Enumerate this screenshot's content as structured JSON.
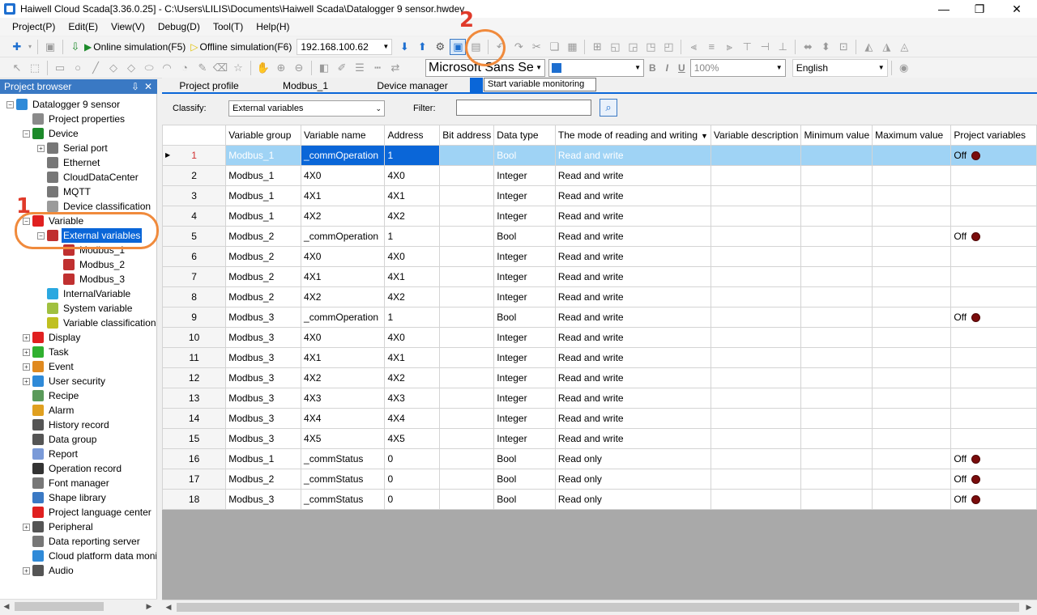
{
  "window": {
    "title": "Haiwell Cloud Scada[3.36.0.25] - C:\\Users\\LILIS\\Documents\\Haiwell Scada\\Datalogger 9 sensor.hwdev",
    "minimize": "—",
    "restore": "❐",
    "close": "✕"
  },
  "menu": [
    "Project(P)",
    "Edit(E)",
    "View(V)",
    "Debug(D)",
    "Tool(T)",
    "Help(H)"
  ],
  "toolbar": {
    "online_sim": "Online simulation(F5)",
    "offline_sim": "Offline simulation(F6)",
    "ip": "192.168.100.62",
    "font": "Microsoft Sans Se",
    "zoom": "100%",
    "language": "English",
    "bold": "B",
    "italic": "I",
    "underline": "U",
    "tooltip": "Start variable monitoring"
  },
  "annotations": {
    "one": "1",
    "two": "2"
  },
  "browser": {
    "title": "Project browser",
    "pin": "⇩",
    "close": "✕",
    "items": [
      {
        "label": "Datalogger 9 sensor",
        "color": "#2f8ad8"
      },
      {
        "label": "Project properties",
        "color": "#8a8a8a"
      },
      {
        "label": "Device",
        "color": "#1c8a2a"
      },
      {
        "label": "Serial port",
        "color": "#777777"
      },
      {
        "label": "Ethernet",
        "color": "#777777"
      },
      {
        "label": "CloudDataCenter",
        "color": "#777777"
      },
      {
        "label": "MQTT",
        "color": "#777777"
      },
      {
        "label": "Device classification",
        "color": "#9a9a9a"
      },
      {
        "label": "Variable",
        "color": "#e02020"
      },
      {
        "label": "External variables",
        "color": "#c03030"
      },
      {
        "label": "Modbus_1",
        "color": "#c03030"
      },
      {
        "label": "Modbus_2",
        "color": "#c03030"
      },
      {
        "label": "Modbus_3",
        "color": "#c03030"
      },
      {
        "label": "InternalVariable",
        "color": "#2aa8e0"
      },
      {
        "label": "System variable",
        "color": "#a0c040"
      },
      {
        "label": "Variable classification",
        "color": "#c0c020"
      },
      {
        "label": "Display",
        "color": "#e02020"
      },
      {
        "label": "Task",
        "color": "#30b030"
      },
      {
        "label": "Event",
        "color": "#e08a20"
      },
      {
        "label": "User security",
        "color": "#2f8ad8"
      },
      {
        "label": "Recipe",
        "color": "#5a9a5a"
      },
      {
        "label": "Alarm",
        "color": "#e0a020"
      },
      {
        "label": "History record",
        "color": "#555555"
      },
      {
        "label": "Data group",
        "color": "#555555"
      },
      {
        "label": "Report",
        "color": "#7a9ad8"
      },
      {
        "label": "Operation record",
        "color": "#333333"
      },
      {
        "label": "Font manager",
        "color": "#777777"
      },
      {
        "label": "Shape library",
        "color": "#3a79c4"
      },
      {
        "label": "Project language center",
        "color": "#e02020"
      },
      {
        "label": "Peripheral",
        "color": "#555555"
      },
      {
        "label": "Data reporting server",
        "color": "#777777"
      },
      {
        "label": "Cloud platform data monitoring",
        "color": "#2f8ad8"
      },
      {
        "label": "Audio",
        "color": "#555555"
      }
    ]
  },
  "tabs": [
    "Project profile",
    "Modbus_1",
    "Device manager",
    ""
  ],
  "classify": {
    "label": "Classify:",
    "value": "External variables",
    "filter_label": "Filter:",
    "filter_value": "",
    "search_icon": "search-icon"
  },
  "table": {
    "columns": [
      "",
      "Variable group",
      "Variable name",
      "Address",
      "Bit address",
      "Data type",
      "The mode of reading and writing",
      "Variable description",
      "Minimum value",
      "Maximum value",
      "Project variables"
    ],
    "rows": [
      [
        "1",
        "Modbus_1",
        "_commOperation",
        "1",
        "",
        "Bool",
        "Read and write",
        "",
        "",
        "",
        "Off"
      ],
      [
        "2",
        "Modbus_1",
        "4X0",
        "4X0",
        "",
        "Integer",
        "Read and write",
        "",
        "",
        "",
        ""
      ],
      [
        "3",
        "Modbus_1",
        "4X1",
        "4X1",
        "",
        "Integer",
        "Read and write",
        "",
        "",
        "",
        ""
      ],
      [
        "4",
        "Modbus_1",
        "4X2",
        "4X2",
        "",
        "Integer",
        "Read and write",
        "",
        "",
        "",
        ""
      ],
      [
        "5",
        "Modbus_2",
        "_commOperation",
        "1",
        "",
        "Bool",
        "Read and write",
        "",
        "",
        "",
        "Off"
      ],
      [
        "6",
        "Modbus_2",
        "4X0",
        "4X0",
        "",
        "Integer",
        "Read and write",
        "",
        "",
        "",
        ""
      ],
      [
        "7",
        "Modbus_2",
        "4X1",
        "4X1",
        "",
        "Integer",
        "Read and write",
        "",
        "",
        "",
        ""
      ],
      [
        "8",
        "Modbus_2",
        "4X2",
        "4X2",
        "",
        "Integer",
        "Read and write",
        "",
        "",
        "",
        ""
      ],
      [
        "9",
        "Modbus_3",
        "_commOperation",
        "1",
        "",
        "Bool",
        "Read and write",
        "",
        "",
        "",
        "Off"
      ],
      [
        "10",
        "Modbus_3",
        "4X0",
        "4X0",
        "",
        "Integer",
        "Read and write",
        "",
        "",
        "",
        ""
      ],
      [
        "11",
        "Modbus_3",
        "4X1",
        "4X1",
        "",
        "Integer",
        "Read and write",
        "",
        "",
        "",
        ""
      ],
      [
        "12",
        "Modbus_3",
        "4X2",
        "4X2",
        "",
        "Integer",
        "Read and write",
        "",
        "",
        "",
        ""
      ],
      [
        "13",
        "Modbus_3",
        "4X3",
        "4X3",
        "",
        "Integer",
        "Read and write",
        "",
        "",
        "",
        ""
      ],
      [
        "14",
        "Modbus_3",
        "4X4",
        "4X4",
        "",
        "Integer",
        "Read and write",
        "",
        "",
        "",
        ""
      ],
      [
        "15",
        "Modbus_3",
        "4X5",
        "4X5",
        "",
        "Integer",
        "Read and write",
        "",
        "",
        "",
        ""
      ],
      [
        "16",
        "Modbus_1",
        "_commStatus",
        "0",
        "",
        "Bool",
        "Read only",
        "",
        "",
        "",
        "Off"
      ],
      [
        "17",
        "Modbus_2",
        "_commStatus",
        "0",
        "",
        "Bool",
        "Read only",
        "",
        "",
        "",
        "Off"
      ],
      [
        "18",
        "Modbus_3",
        "_commStatus",
        "0",
        "",
        "Bool",
        "Read only",
        "",
        "",
        "",
        "Off"
      ]
    ],
    "selected_row": 0,
    "status_dot_color": "#7a0c0c"
  }
}
